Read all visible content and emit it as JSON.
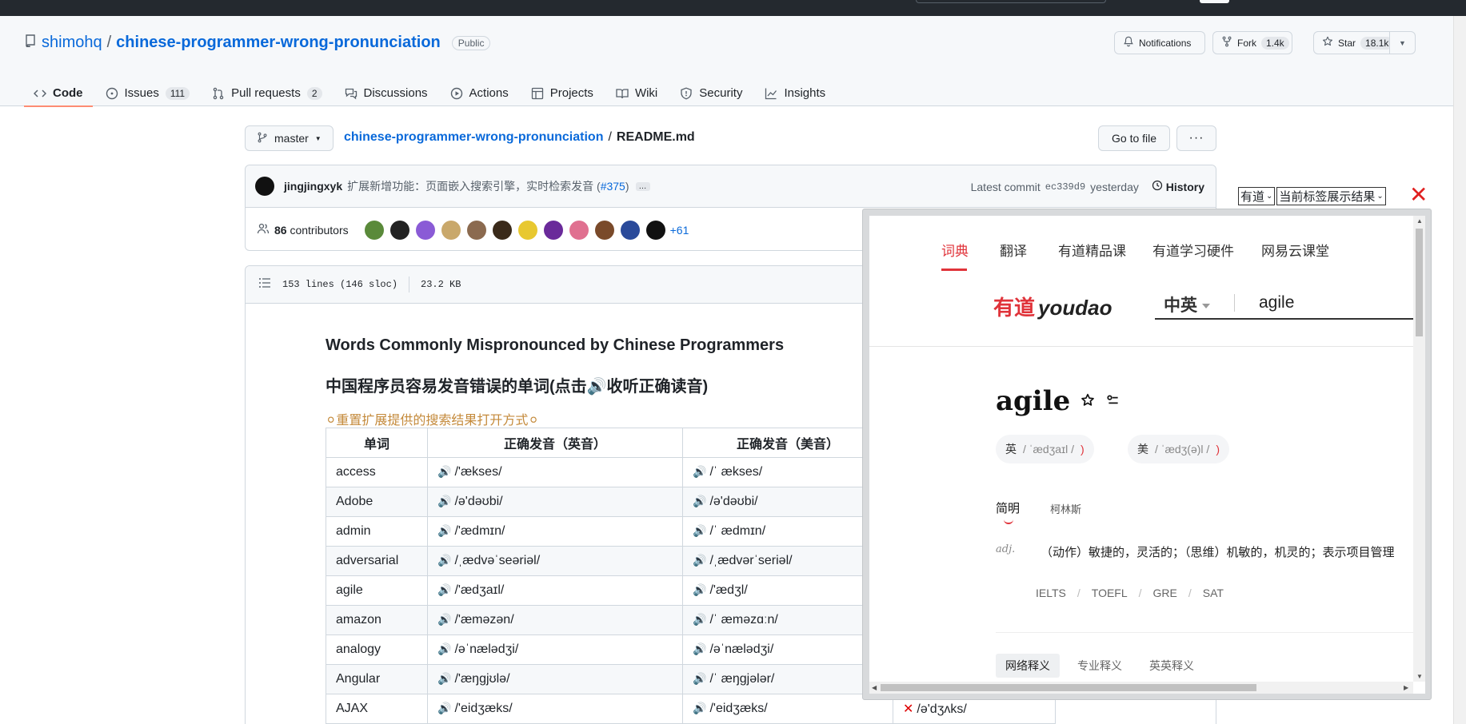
{
  "repo": {
    "owner": "shimohq",
    "separator": "/",
    "name": "chinese-programmer-wrong-pronunciation",
    "visibility": "Public"
  },
  "header_actions": {
    "notifications": "Notifications",
    "fork_label": "Fork",
    "fork_count": "1.4k",
    "star_label": "Star",
    "star_count": "18.1k"
  },
  "tabs": [
    {
      "label": "Code",
      "icon": "code-icon",
      "count": ""
    },
    {
      "label": "Issues",
      "icon": "issue-icon",
      "count": "111"
    },
    {
      "label": "Pull requests",
      "icon": "pull-request-icon",
      "count": "2"
    },
    {
      "label": "Discussions",
      "icon": "discussion-icon",
      "count": ""
    },
    {
      "label": "Actions",
      "icon": "play-icon",
      "count": ""
    },
    {
      "label": "Projects",
      "icon": "table-icon",
      "count": ""
    },
    {
      "label": "Wiki",
      "icon": "book-icon",
      "count": ""
    },
    {
      "label": "Security",
      "icon": "shield-icon",
      "count": ""
    },
    {
      "label": "Insights",
      "icon": "graph-icon",
      "count": ""
    }
  ],
  "file_nav": {
    "branch": "master",
    "repo_link": "chinese-programmer-wrong-pronunciation",
    "sep": "/",
    "file": "README.md",
    "go_to_file": "Go to file",
    "more": "···"
  },
  "commit": {
    "author": "jingjingxyk",
    "message": "扩展新增功能：页面嵌入搜索引擎，实时检索发音 (",
    "pr_link": "#375",
    "message_end": ")",
    "ellipsis": "…",
    "latest_label": "Latest commit",
    "sha": "ec339d9",
    "when": "yesterday",
    "history": "History"
  },
  "contributors": {
    "count": "86",
    "label": "contributors",
    "more": "+61",
    "avatar_colors": [
      "#5a8a3a",
      "#222222",
      "#8a5bd6",
      "#c9a86b",
      "#8b6a4f",
      "#3a2a1a",
      "#e8c830",
      "#6a2a9a",
      "#e07090",
      "#7a4a2a",
      "#2a4a9a",
      "#111111"
    ]
  },
  "file_info": {
    "lines": "153 lines (146 sloc)",
    "size": "23.2 KB"
  },
  "readme": {
    "title_en": "Words Commonly Mispronounced by Chinese Programmers",
    "title_cn": "中国程序员容易发音错误的单词(点击🔊收听正确读音)",
    "reset_text": "⚪重置扩展提供的搜索结果打开方式⚪",
    "table": {
      "headers": [
        "单词",
        "正确发音（英音）",
        "正确发音（美音）"
      ],
      "rows": [
        {
          "word": "access",
          "uk": "/'ækses/",
          "us": "/ˈ ækses/",
          "wrong": ""
        },
        {
          "word": "Adobe",
          "uk": "/ə'dəʊbi/",
          "us": "/ə'dəʊbi/",
          "wrong": ""
        },
        {
          "word": "admin",
          "uk": "/'ædmɪn/",
          "us": "/ˈ ædmɪn/",
          "wrong": ""
        },
        {
          "word": "adversarial",
          "uk": "/ˌædvəˈseəriəl/",
          "us": "/ˌædvərˈseriəl/",
          "wrong": ""
        },
        {
          "word": "agile",
          "uk": "/'ædʒaɪl/",
          "us": "/'ædʒl/",
          "wrong": ""
        },
        {
          "word": "amazon",
          "uk": "/'æməzən/",
          "us": "/ˈ æməzɑːn/",
          "wrong": ""
        },
        {
          "word": "analogy",
          "uk": "/əˈnælədʒi/",
          "us": "/əˈnælədʒi/",
          "wrong": ""
        },
        {
          "word": "Angular",
          "uk": "/'æŋgjʊlə/",
          "us": "/ˈ æŋgjələr/",
          "wrong": ""
        },
        {
          "word": "AJAX",
          "uk": "/'eidʒæks/",
          "us": "/'eidʒæks/",
          "wrong": "/ə'dʒʌks/"
        }
      ]
    }
  },
  "extension": {
    "engine": "有道",
    "mode": "当前标签展示结果",
    "close": "✕"
  },
  "youdao": {
    "nav": [
      "词典",
      "翻译",
      "有道精品课",
      "有道学习硬件",
      "网易云课堂"
    ],
    "logo_cn": "有道",
    "logo_en": "youdao",
    "lang": "中英",
    "query": "agile",
    "word": "agile",
    "uk_label": "英",
    "uk_phonetic": "/ ˈædʒaɪl /",
    "us_label": "美",
    "us_phonetic": "/ ˈædʒ(ə)l /",
    "def_tabs": [
      "简明",
      "柯林斯"
    ],
    "pos": "adj.",
    "definition": "（动作）敏捷的，灵活的；（思维）机敏的，机灵的；表示项目管理",
    "exams": [
      "IELTS",
      "TOEFL",
      "GRE",
      "SAT"
    ],
    "bottom_tabs": [
      "网络释义",
      "专业释义",
      "英英释义"
    ]
  },
  "colors": {
    "github_accent": "#0969da",
    "tab_underline": "#fd8c73",
    "youdao_red": "#e0333a"
  }
}
